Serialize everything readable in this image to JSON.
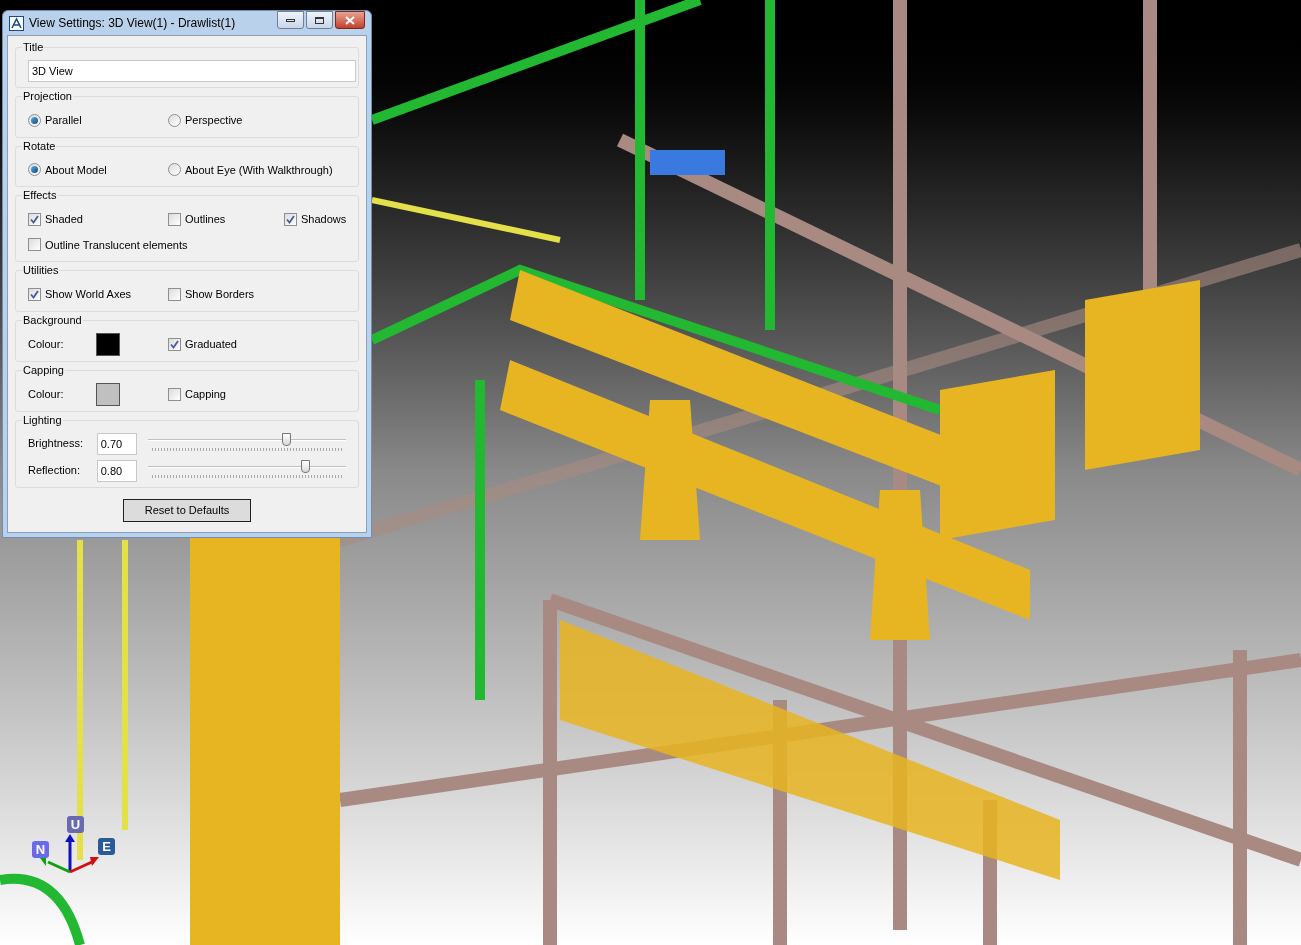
{
  "window": {
    "title": "View Settings: 3D View(1) - Drawlist(1)"
  },
  "sections": [
    {
      "kind": "text",
      "label": "Title",
      "value": "3D View"
    },
    {
      "kind": "radios",
      "label": "Projection",
      "options": [
        {
          "label": "Parallel",
          "selected": true
        },
        {
          "label": "Perspective",
          "selected": false
        }
      ]
    },
    {
      "kind": "radios",
      "label": "Rotate",
      "options": [
        {
          "label": "About Model",
          "selected": true
        },
        {
          "label": "About Eye (With Walkthrough)",
          "selected": false
        }
      ]
    },
    {
      "kind": "checks",
      "label": "Effects",
      "options": [
        {
          "label": "Shaded",
          "checked": true
        },
        {
          "label": "Outlines",
          "checked": false
        },
        {
          "label": "Shadows",
          "checked": true
        },
        {
          "label": "Outline Translucent elements",
          "checked": false
        }
      ]
    },
    {
      "kind": "checks",
      "label": "Utilities",
      "options": [
        {
          "label": "Show World Axes",
          "checked": true
        },
        {
          "label": "Show Borders",
          "checked": false
        }
      ]
    },
    {
      "kind": "colour",
      "label": "Background",
      "field": "Colour:",
      "color": "#000000",
      "option": {
        "label": "Graduated",
        "checked": true
      }
    },
    {
      "kind": "colour",
      "label": "Capping",
      "field": "Colour:",
      "color": "#c0c0c0",
      "option": {
        "label": "Capping",
        "checked": false
      }
    },
    {
      "kind": "sliders",
      "label": "Lighting",
      "rows": [
        {
          "label": "Brightness:",
          "value": "0.70",
          "level": 0.7
        },
        {
          "label": "Reflection:",
          "value": "0.80",
          "level": 0.8
        }
      ]
    }
  ],
  "reset_button": "Reset to Defaults",
  "axes": [
    {
      "kind": "north",
      "label": "N"
    },
    {
      "kind": "up",
      "label": "U"
    },
    {
      "kind": "east",
      "label": "E"
    }
  ]
}
